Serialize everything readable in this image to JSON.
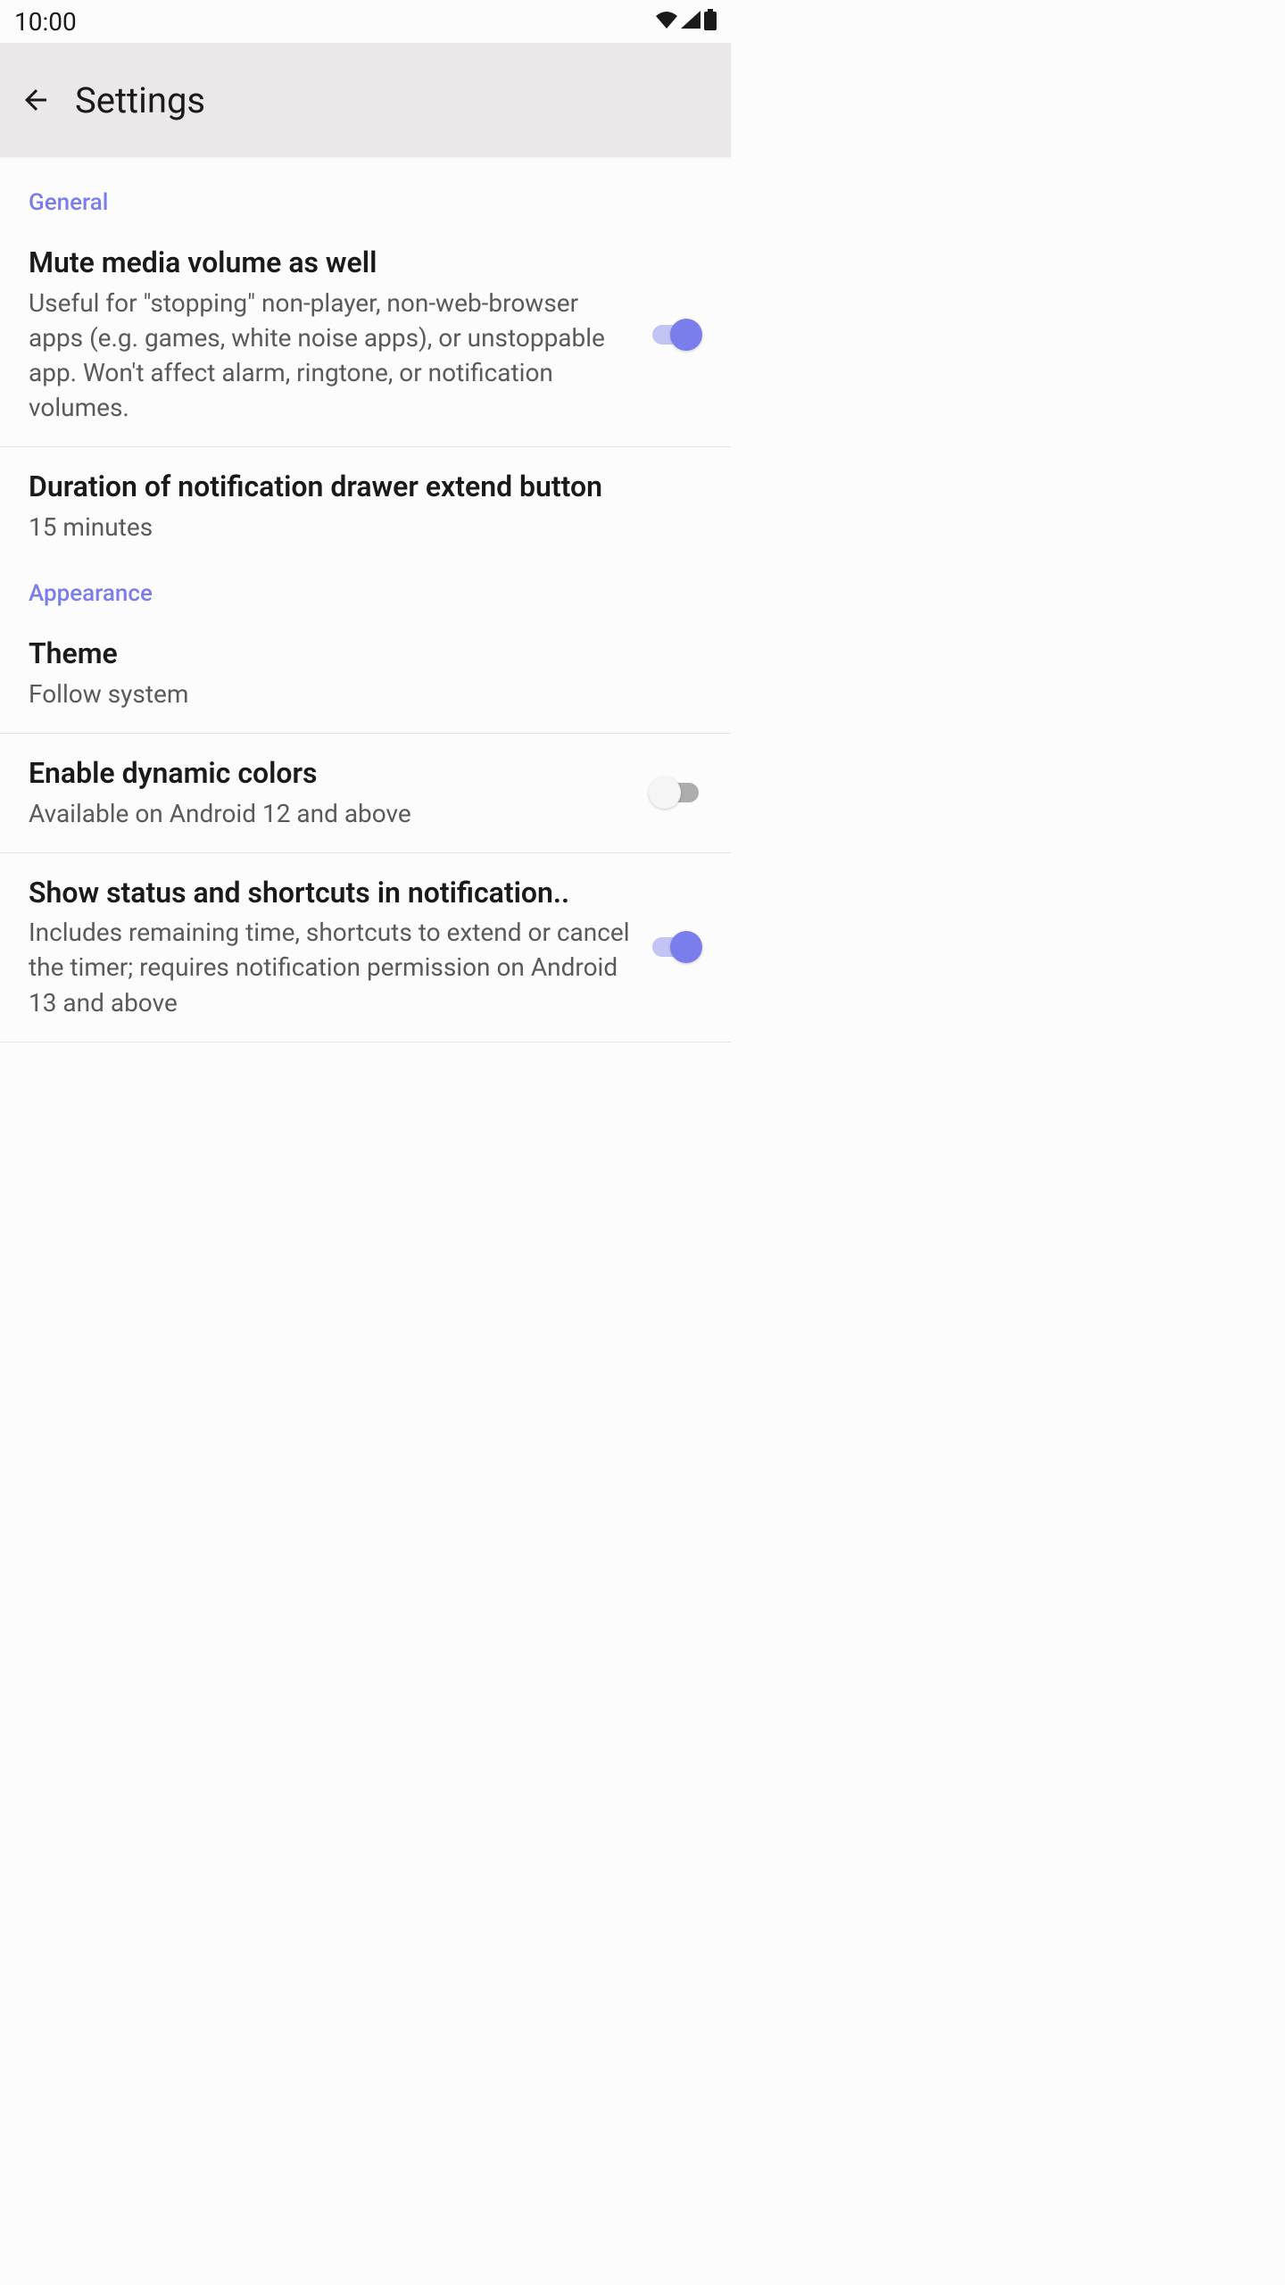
{
  "statusBar": {
    "time": "10:00"
  },
  "appBar": {
    "title": "Settings"
  },
  "sections": {
    "general": {
      "header": "General",
      "muteMedia": {
        "title": "Mute media volume as well",
        "description": "Useful for \"stopping\" non-player, non-web-browser apps (e.g. games, white noise apps), or unstoppable app. Won't affect alarm, ringtone, or notification volumes.",
        "enabled": true
      },
      "duration": {
        "title": "Duration of notification drawer extend button",
        "value": "15 minutes"
      }
    },
    "appearance": {
      "header": "Appearance",
      "theme": {
        "title": "Theme",
        "value": "Follow system"
      },
      "dynamicColors": {
        "title": "Enable dynamic colors",
        "description": "Available on Android 12 and above",
        "enabled": false
      },
      "showStatus": {
        "title": "Show status and shortcuts in notification..",
        "description": "Includes remaining time, shortcuts to extend or cancel the timer; requires notification permission on Android 13 and above",
        "enabled": true
      }
    }
  }
}
